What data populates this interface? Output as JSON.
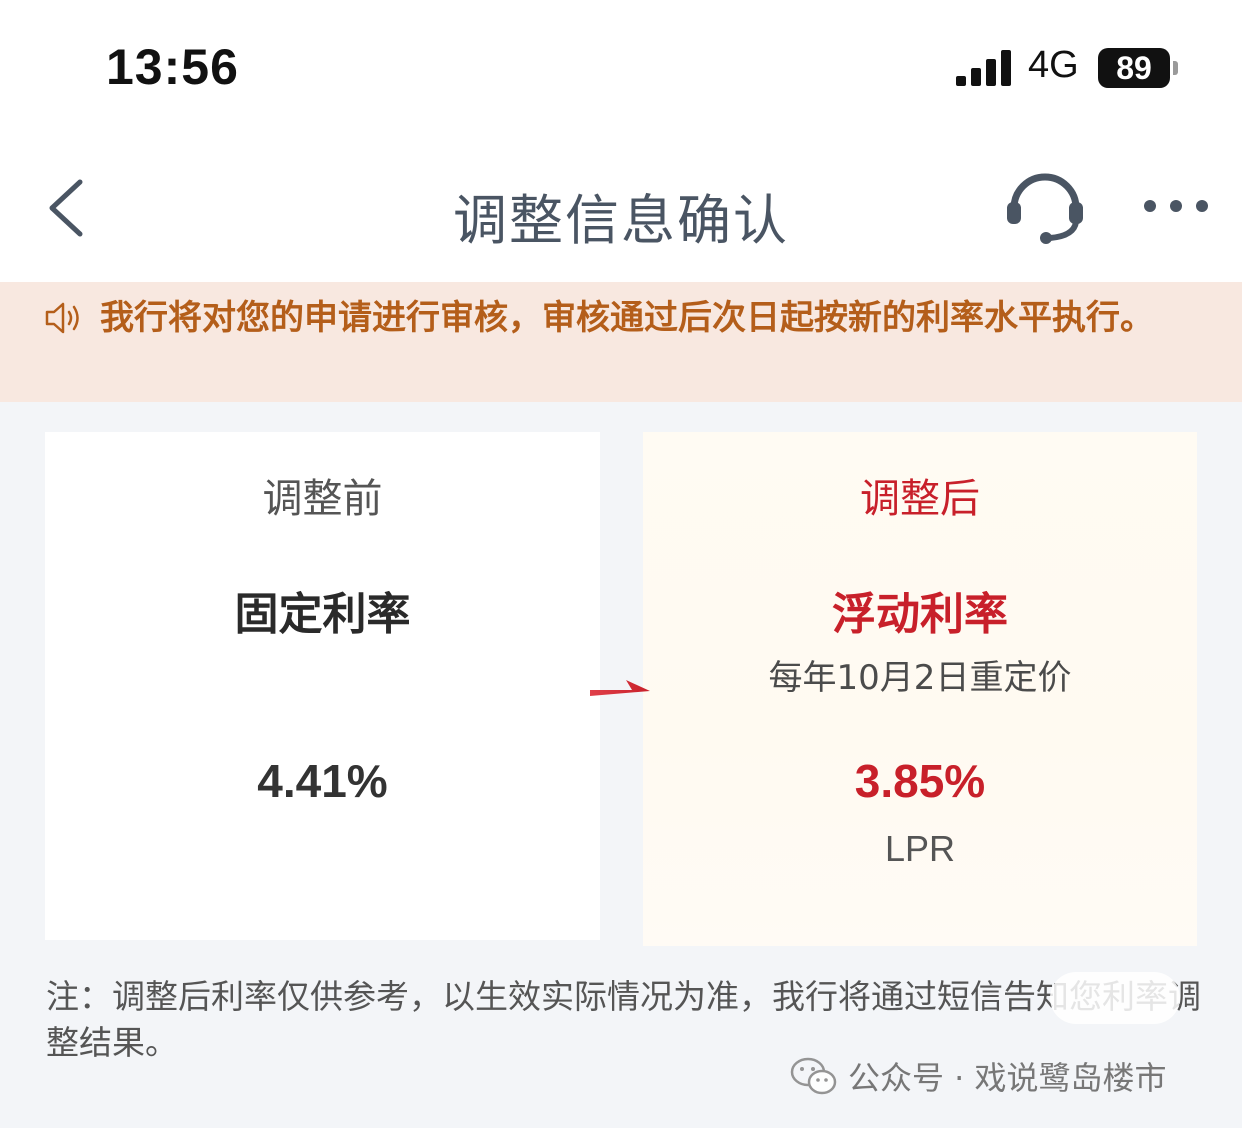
{
  "status_bar": {
    "time": "13:56",
    "network": "4G",
    "battery": "89"
  },
  "header": {
    "title": "调整信息确认",
    "back_icon": "chevron-left-icon",
    "support_icon": "headset-icon",
    "more_icon": "more-icon"
  },
  "notice": {
    "text": "我行将对您的申请进行审核，审核通过后次日起按新的利率水平执行。"
  },
  "before": {
    "heading": "调整前",
    "rate_type": "固定利率",
    "value": "4.41%"
  },
  "after": {
    "heading": "调整后",
    "rate_type": "浮动利率",
    "reprice": "每年10月2日重定价",
    "value": "3.85%",
    "basis": "LPR"
  },
  "footnote": {
    "text": "注：调整后利率仅供参考，以生效实际情况为准，我行将通过短信告知您利率调整结果。"
  },
  "watermark": {
    "text": "公众号 · 戏说鹭岛楼市"
  },
  "colors": {
    "accent_red": "#c8202a",
    "notice_bg": "#f8e8e0",
    "notice_text": "#b45e1a",
    "page_bg": "#f3f5f8"
  }
}
